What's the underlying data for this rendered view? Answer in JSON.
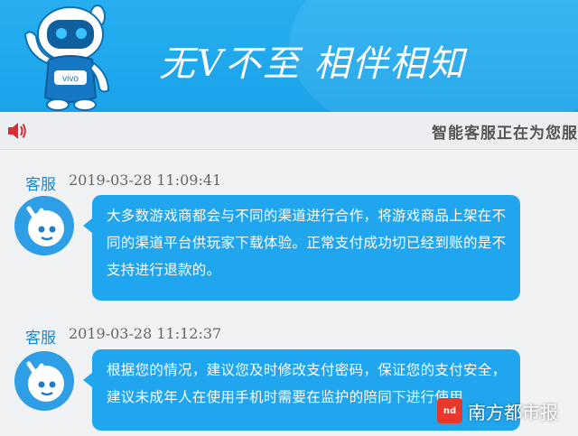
{
  "banner": {
    "slogan": "无V不至 相伴相知",
    "mascot_icon": "robot-mascot-icon",
    "mascot_badge": "vivo",
    "color": "#1fa8ee"
  },
  "notice": {
    "speaker_icon": "speaker-icon",
    "text": "智能客服正在为您服务"
  },
  "messages": [
    {
      "sender": "客服",
      "time": "2019-03-28 11:09:41",
      "text": "大多数游戏商都会与不同的渠道进行合作，将游戏商品上架在不同的渠道平台供玩家下载体验。正常支付成功切已经到账的是不支持进行退款的。"
    },
    {
      "sender": "客服",
      "time": "2019-03-28 11:12:37",
      "text": "根据您的情况，建议您及时修改支付密码，保证您的支付安全，建议未成年人在使用手机时需要在监护的陪同下进行使用"
    }
  ],
  "watermark": {
    "logo_text": "nd",
    "text": "南方都市报"
  }
}
